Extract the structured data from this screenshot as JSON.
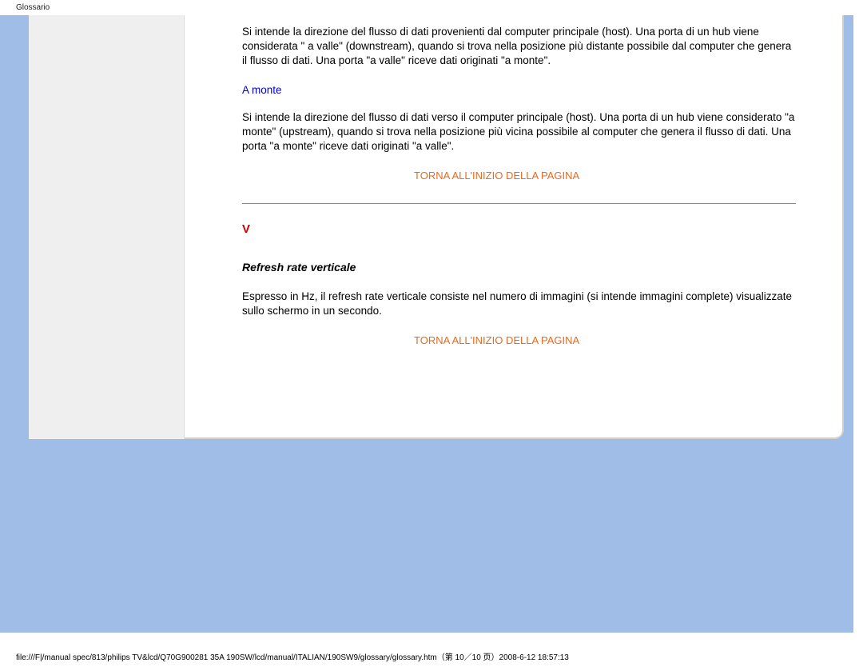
{
  "header": {
    "label": "Glossario"
  },
  "glossary": {
    "a_valle_definition": "Si intende la direzione del flusso di dati provenienti dal computer principale (host). Una porta di un hub viene considerata \" a valle\" (downstream), quando si trova nella posizione più distante possibile dal computer che genera il flusso di dati. Una porta \"a valle\" riceve dati originati \"a monte\".",
    "a_monte_term": "A monte",
    "a_monte_definition": "Si intende la direzione del flusso di dati verso il computer principale (host). Una porta di un hub viene considerato \"a monte\" (upstream), quando si trova nella posizione più vicina possibile al computer che genera il flusso di dati. Una porta \"a monte\" riceve dati originati \"a valle\".",
    "back_to_top": "TORNA ALL'INIZIO DELLA PAGINA",
    "section_v": {
      "letter": "V",
      "refresh_rate_term": "Refresh rate verticale",
      "refresh_rate_definition": "Espresso in Hz, il refresh rate verticale consiste nel numero di immagini (si intende immagini complete) visualizzate sullo schermo in un secondo."
    }
  },
  "footer": {
    "path": "file:///F|/manual spec/813/philips TV&lcd/Q70G900281 35A 190SW/lcd/manual/ITALIAN/190SW9/glossary/glossary.htm（第 10／10 页）2008-6-12 18:57:13"
  }
}
